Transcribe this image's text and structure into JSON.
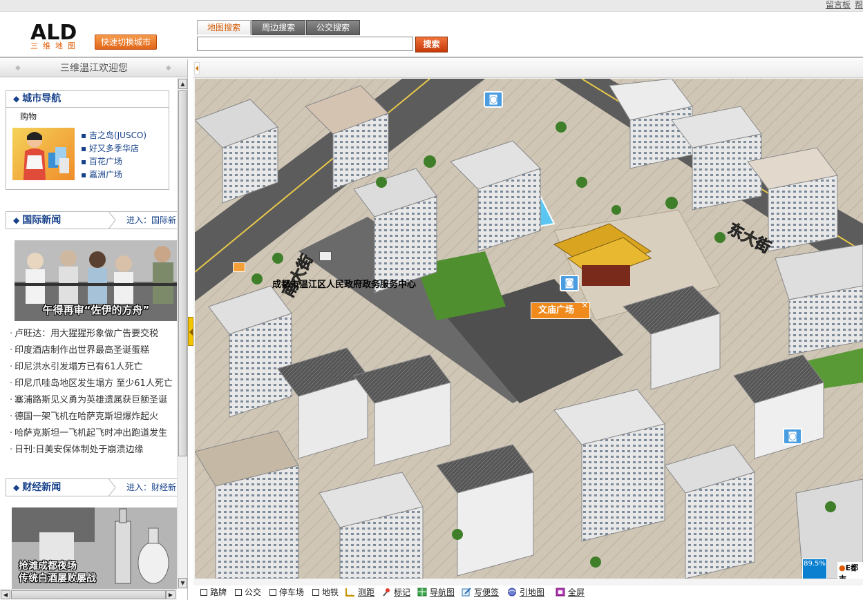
{
  "top_links": [
    "留言板",
    "帮"
  ],
  "logo": {
    "main": "ALD",
    "sub": "三维地图"
  },
  "header": {
    "switch_city": "快速切换城市",
    "search_button": "搜索"
  },
  "search": {
    "tabs": [
      {
        "label": "地图搜索",
        "active": true
      },
      {
        "label": "周边搜索",
        "active": false
      },
      {
        "label": "公交搜索",
        "active": false
      }
    ],
    "value": ""
  },
  "sidebar": {
    "welcome": "三维温江欢迎您",
    "city_nav": {
      "title": "城市导航",
      "category": "购物",
      "items": [
        "吉之岛(JUSCO)",
        "好又多季华店",
        "百花广场",
        "嘉洲广场"
      ]
    },
    "intl_news": {
      "title": "国际新闻",
      "more": "进入：国际新",
      "photo_caption": "午得再审“佐伊的方舟”",
      "items": [
        "卢旺达：用大猩猩形象做广告要交税",
        "印度酒店制作出世界最高圣诞蛋糕",
        "印尼洪水引发塌方已有61人死亡",
        "印尼爪哇岛地区发生塌方  至少61人死亡",
        "塞浦路斯见义勇为英雄遗属获巨额圣诞",
        "德国一架飞机在哈萨克斯坦爆炸起火",
        "哈萨克斯坦一飞机起飞时冲出跑道发生",
        "日刊:日美安保体制处于崩溃边缘"
      ]
    },
    "finance_news": {
      "title": "财经新闻",
      "more": "进入：财经新",
      "photo_caption": [
        "抢滩成都夜场",
        "传统白酒屡败屡战"
      ]
    }
  },
  "map": {
    "road_east": "东大街",
    "road_south": "南大街",
    "building_label": "成都市温江区人民政府政务服务中心",
    "place_tag": "文庙广场",
    "zoom": "89.5%",
    "brand": "E都市"
  },
  "map_toolbar": {
    "checkboxes": [
      "路牌",
      "公交",
      "停车场",
      "地铁"
    ],
    "tools": [
      "测距",
      "标记",
      "导航图",
      "写便签",
      "引地图",
      "全屏"
    ]
  },
  "colors": {
    "accent": "#e2661a",
    "nav_blue": "#16418a",
    "tag_orange": "#f08a1c"
  }
}
